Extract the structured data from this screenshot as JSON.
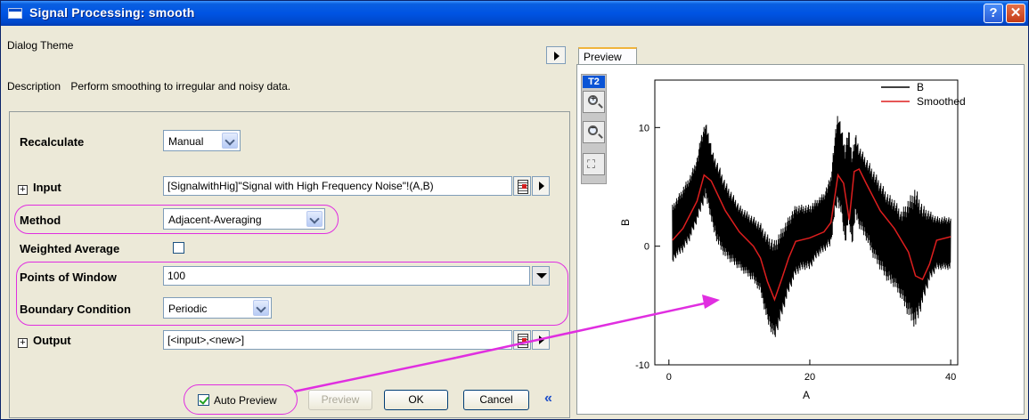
{
  "window": {
    "title": "Signal Processing: smooth",
    "help_glyph": "?",
    "close_glyph": "✕"
  },
  "dialog": {
    "theme_label": "Dialog Theme",
    "description_label": "Description",
    "description_text": "Perform smoothing to irregular and noisy data.",
    "recalculate": {
      "label": "Recalculate",
      "value": "Manual"
    },
    "input": {
      "label": "Input",
      "value": "[SignalwithHig]\"Signal with High Frequency Noise\"!(A,B)"
    },
    "method": {
      "label": "Method",
      "value": "Adjacent-Averaging"
    },
    "weighted_average": {
      "label": "Weighted Average",
      "checked": false
    },
    "points_of_window": {
      "label": "Points of Window",
      "value": "100"
    },
    "boundary_condition": {
      "label": "Boundary Condition",
      "value": "Periodic"
    },
    "output": {
      "label": "Output",
      "value": "[<input>,<new>]"
    },
    "expand_glyph": "+",
    "collapse_glyph": "«"
  },
  "buttons": {
    "auto_preview": {
      "label": "Auto Preview",
      "checked": true
    },
    "preview": "Preview",
    "ok": "OK",
    "cancel": "Cancel"
  },
  "preview": {
    "tab_label": "Preview",
    "layer_badge": "T2",
    "tools": [
      "zoom-in-icon",
      "zoom-out-icon",
      "rescale-icon"
    ]
  },
  "colors": {
    "title_bar": "#0054e3",
    "highlight": "#e02ee0",
    "series_raw": "#000000",
    "series_smooth": "#dd1e1e"
  },
  "chart_data": {
    "type": "line",
    "xlabel": "A",
    "ylabel": "B",
    "xlim": [
      -2,
      41
    ],
    "ylim": [
      -10,
      14
    ],
    "x_ticks": [
      "0",
      "20",
      "40"
    ],
    "y_ticks": [
      "10",
      "0",
      "-10"
    ],
    "legend_position": "top-right",
    "series": [
      {
        "name": "B",
        "style": "noisy",
        "x": [
          0.5,
          1,
          2,
          3,
          4,
          4.6,
          5.2,
          5.7,
          6.2,
          7,
          8,
          9,
          10,
          11,
          12,
          13,
          14,
          15,
          16,
          17,
          18,
          19,
          20,
          21,
          22,
          23,
          23.5,
          24,
          24.5,
          25,
          25.5,
          26,
          26.5,
          27,
          28,
          29,
          30,
          31,
          32,
          33,
          34,
          35,
          36,
          37,
          38,
          39,
          40
        ],
        "y_max": [
          3.5,
          4,
          5,
          6,
          7.5,
          9.5,
          10.5,
          9.5,
          8,
          7,
          5.5,
          4.5,
          3.5,
          3,
          2.5,
          2,
          1,
          0.5,
          1.5,
          2.5,
          3.5,
          3.5,
          3.5,
          4,
          4.5,
          6,
          9,
          11.5,
          10,
          8.5,
          10,
          8,
          9.5,
          8.5,
          7.5,
          6.5,
          5.5,
          4.5,
          4,
          3,
          4,
          5,
          3.5,
          3,
          2.5,
          2.5,
          2.5
        ],
        "y_min": [
          -1.5,
          -1,
          -0.5,
          0.5,
          2,
          3,
          4,
          3,
          1.5,
          0,
          -1,
          -1.5,
          -2,
          -2.5,
          -3,
          -4,
          -6.5,
          -8,
          -6,
          -4,
          -2.5,
          -2,
          -2,
          -1,
          -0.5,
          0,
          2.5,
          3.5,
          2.5,
          0,
          2,
          0,
          2.5,
          1.5,
          0.5,
          -1,
          -2,
          -3,
          -3.5,
          -4.5,
          -6,
          -7,
          -5,
          -3,
          -2,
          -2,
          -2
        ]
      },
      {
        "name": "Smoothed",
        "style": "line",
        "x": [
          0.5,
          2,
          4,
          5,
          6,
          8,
          10,
          12,
          13,
          14,
          15,
          16,
          17,
          18,
          20,
          22,
          23,
          24,
          24.8,
          25.6,
          26.3,
          27,
          28,
          30,
          32,
          34,
          35,
          36,
          37,
          38,
          40
        ],
        "y": [
          0.5,
          1.5,
          3.8,
          6,
          5.5,
          3,
          1.2,
          0,
          -1,
          -3,
          -4.5,
          -2.8,
          -1,
          0.4,
          0.7,
          1.2,
          2,
          6,
          5.3,
          2.2,
          6.3,
          6.5,
          5.3,
          3,
          1.5,
          -0.5,
          -2.5,
          -2.8,
          -1.5,
          0.5,
          0.8
        ]
      }
    ]
  }
}
